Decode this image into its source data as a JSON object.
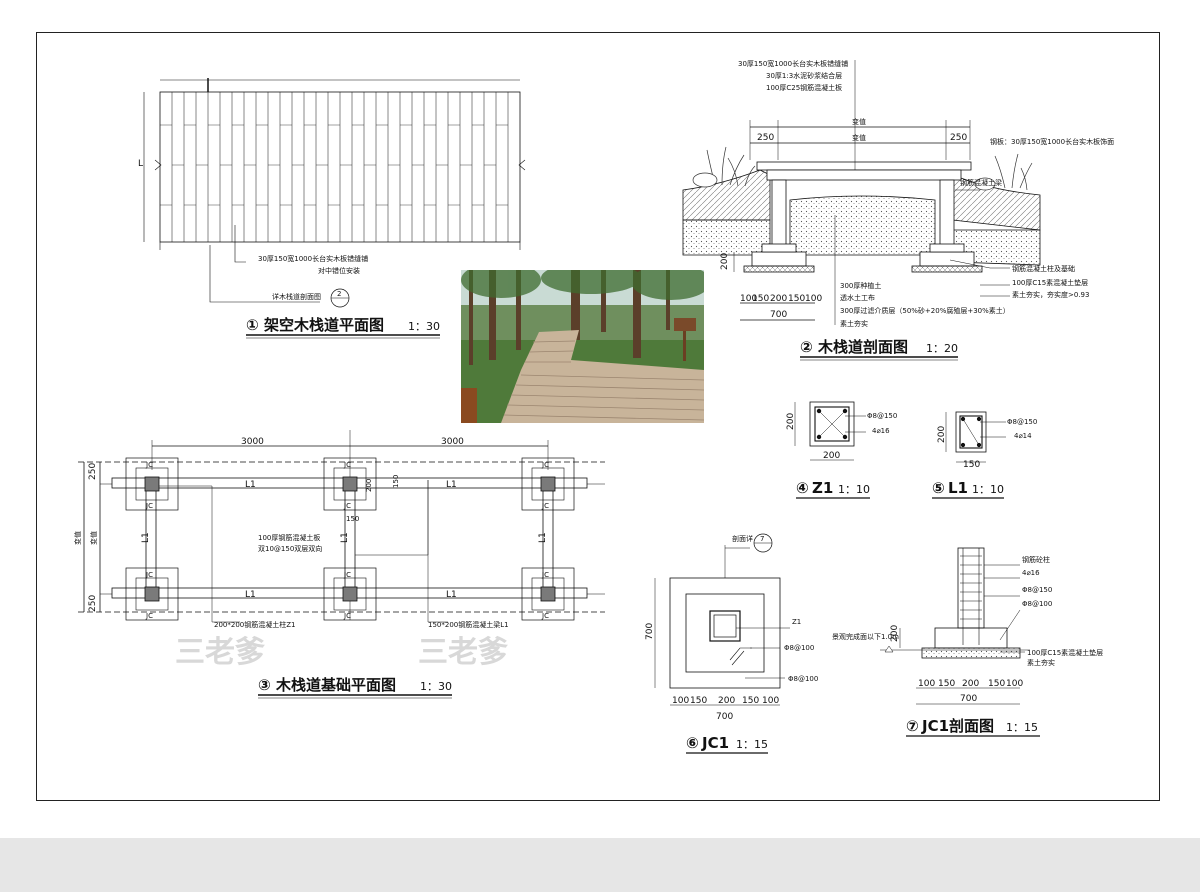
{
  "drawings": {
    "plan1": {
      "num": "①",
      "title": "架空木栈道平面图",
      "scale": "1：30",
      "note1": "30厚150宽1000长台实木板错缝铺",
      "note2": "对中错位安装",
      "callout": "详木栈道剖面图",
      "callout_num": "2",
      "dim_l": "L"
    },
    "section2": {
      "num": "②",
      "title": "木栈道剖面图",
      "scale": "1：20",
      "top_notes": [
        "30厚150宽1000长台实木板错缝铺",
        "30厚1:3水泥砂浆结合层",
        "100厚C25钢筋混凝土板"
      ],
      "dim_var": "变值",
      "dim_250": "250",
      "right_note": "钢板：30厚150宽1000长台实木板饰面",
      "rail_note": "钢筋混凝土梁",
      "side_notes": [
        "钢筋混凝土柱及基础",
        "100厚C15素混凝土垫层",
        "素土夯实，夯实度>0.93"
      ],
      "bottom_notes": [
        "300厚种植土",
        "透水土工布",
        "300厚过滤介质层（50%砂+20%腐殖层+30%素土）",
        "素土夯实"
      ],
      "dims_bottom": [
        "100",
        "150",
        "200",
        "150",
        "100"
      ],
      "dim_700": "700",
      "dim_200": "200",
      "dim_100": "100"
    },
    "plan3": {
      "num": "③",
      "title": "木栈道基础平面图",
      "scale": "1：30",
      "dim_3000a": "3000",
      "dim_3000b": "3000",
      "dim_250": "250",
      "dim_var": "变值",
      "beam": "L1",
      "footing": "JC",
      "col": "Z1",
      "slab_note1": "100厚钢筋混凝土板",
      "slab_note2": "双10@150双层双向",
      "col_note": "200*200钢筋混凝土柱Z1",
      "beam_note": "150*200钢筋混凝土梁L1",
      "d150": "150",
      "d200": "200"
    },
    "z1": {
      "num": "④",
      "title": "Z1",
      "scale": "1：10",
      "dim_w": "200",
      "dim_h": "200",
      "r1": "Φ8@150",
      "r2": "4⌀16"
    },
    "l1": {
      "num": "⑤",
      "title": "L1",
      "scale": "1：10",
      "dim_w": "150",
      "dim_h": "200",
      "r1": "Φ8@150",
      "r2": "4⌀14"
    },
    "jc1": {
      "num": "⑥",
      "title": "JC1",
      "scale": "1：15",
      "callout": "剖面详",
      "callout_num": "7",
      "z1": "Z1",
      "r1": "Φ8@100",
      "r2": "Φ8@100",
      "dims": [
        "100",
        "150",
        "200",
        "150",
        "100"
      ],
      "dim_700": "700"
    },
    "jc1s": {
      "num": "⑦",
      "title": "JC1剖面图",
      "scale": "1：15",
      "notes": [
        "钢筋砼柱",
        "4⌀16",
        "Φ8@150",
        "Φ8@100",
        "100厚C15素混凝土垫层",
        "素土夯实"
      ],
      "ground": "景观完成面以下1.0m",
      "dims": [
        "100",
        "150",
        "200",
        "150",
        "100"
      ],
      "dim_700": "700",
      "dim_200": "200"
    }
  },
  "watermark": "三老爹",
  "colors": {
    "line": "#111111",
    "hatch": "#555555",
    "column": "#7a7a7a",
    "paper": "#ffffff",
    "bg": "#e6e6e6"
  }
}
